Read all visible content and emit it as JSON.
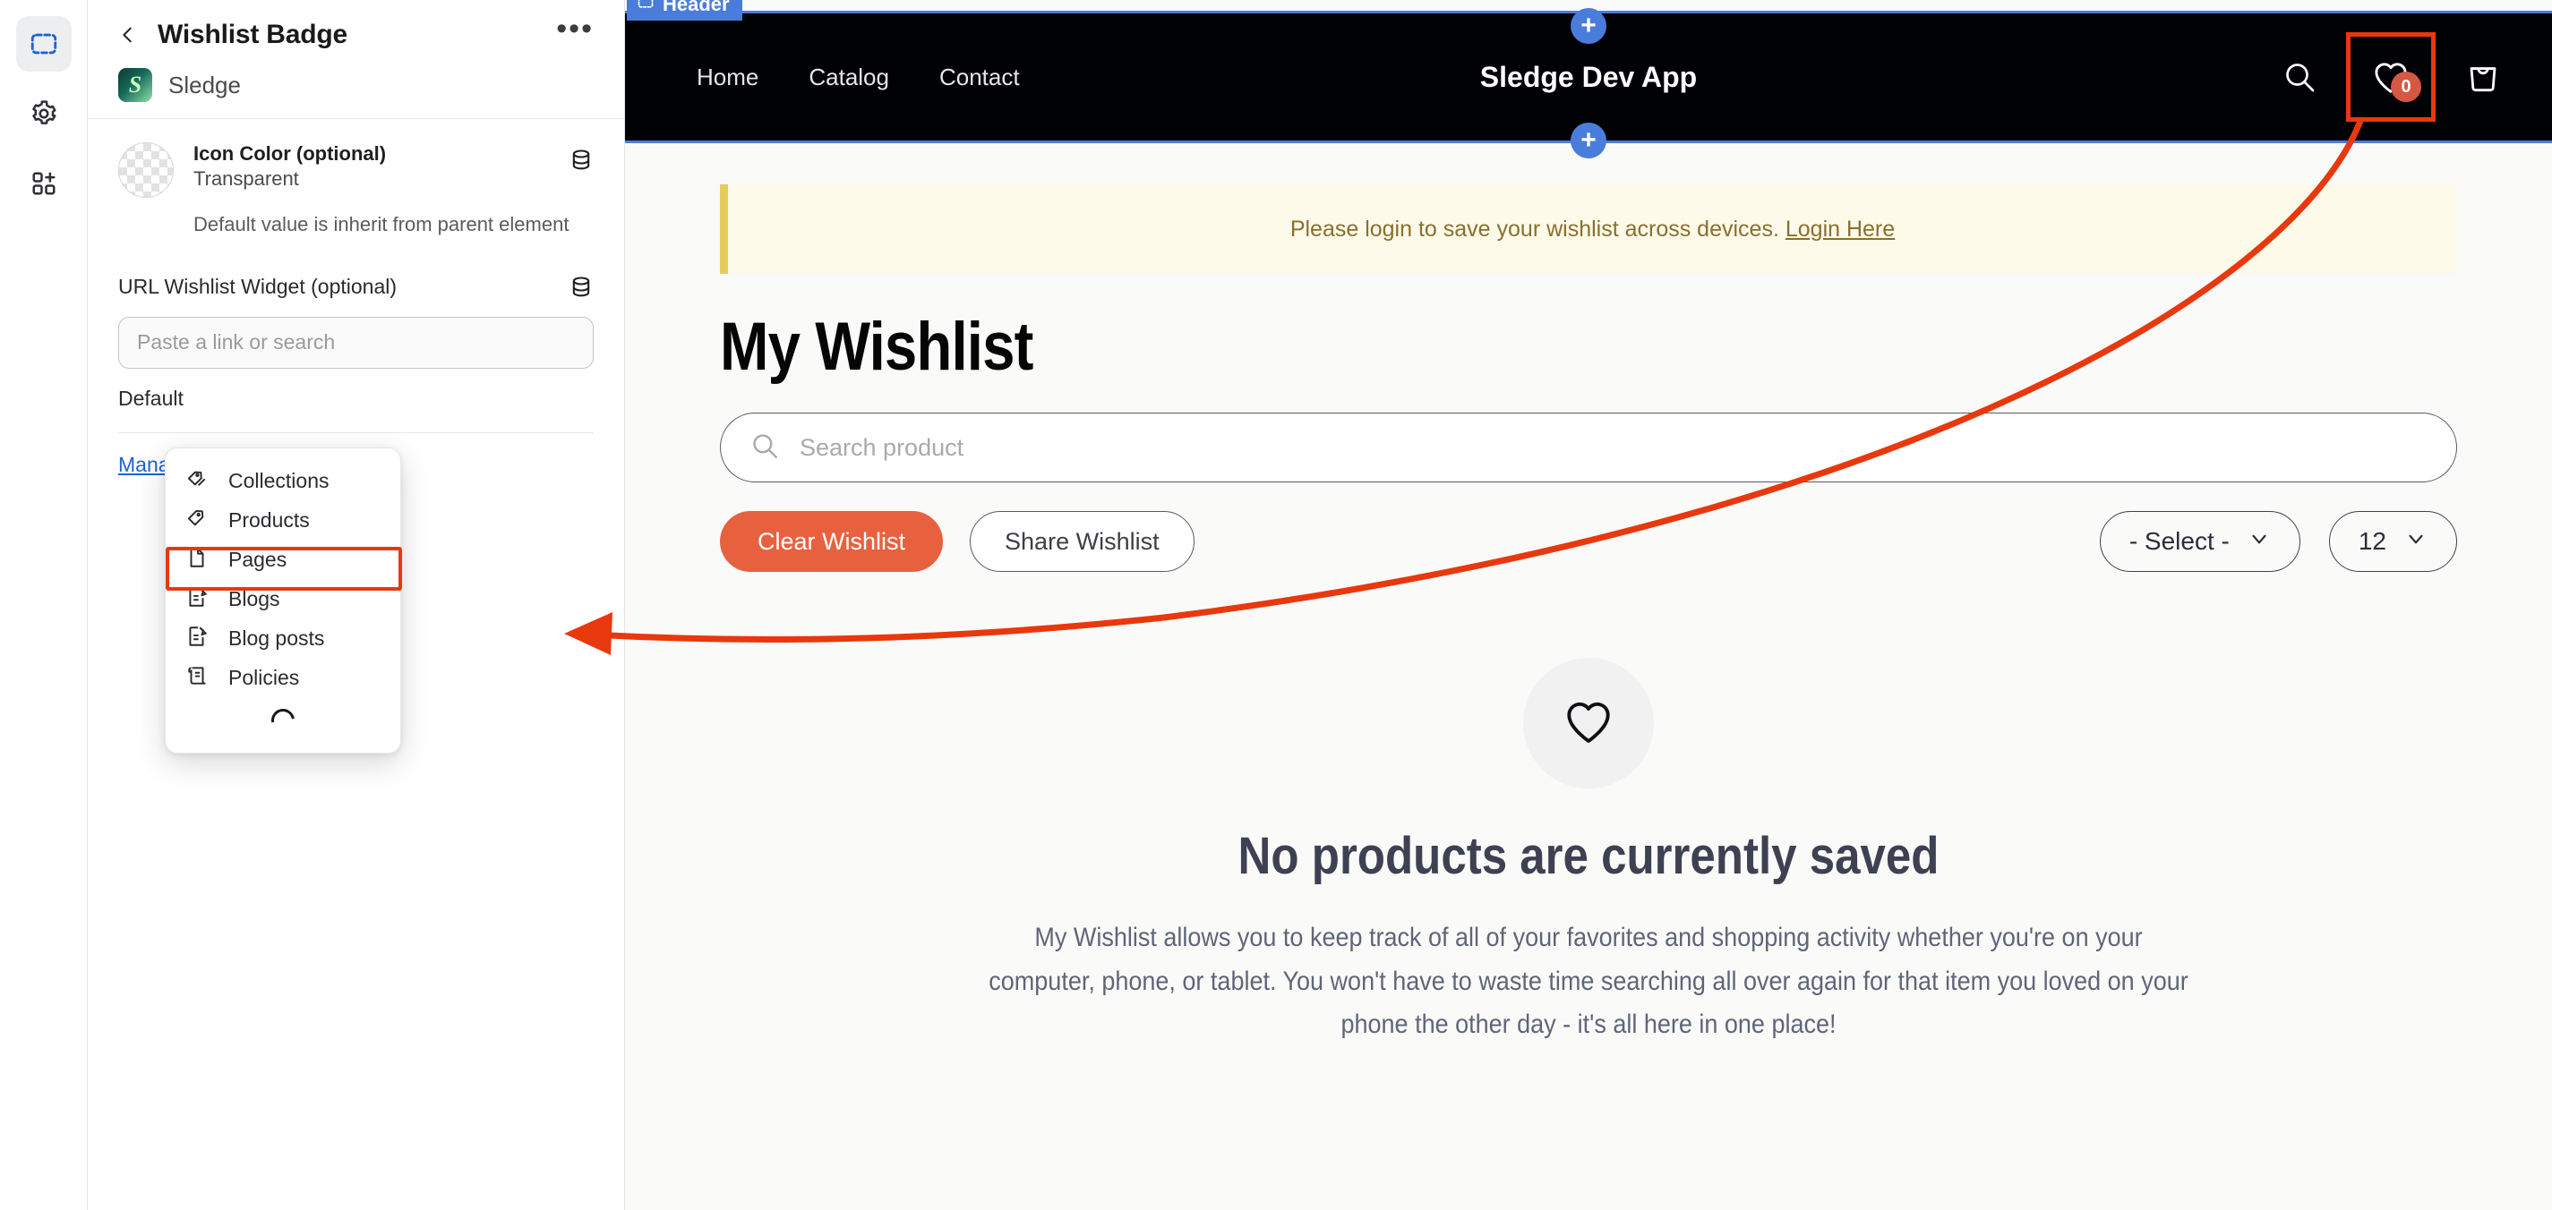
{
  "rail": {
    "items": [
      {
        "name": "sections-icon",
        "label": "Sections",
        "active": true
      },
      {
        "name": "gear-icon",
        "label": "Settings",
        "active": false
      },
      {
        "name": "apps-add-icon",
        "label": "Apps",
        "active": false
      }
    ]
  },
  "panel": {
    "back_label": "Back",
    "title": "Wishlist Badge",
    "more_label": "•••",
    "app_name": "Sledge",
    "app_logo_glyph": "S",
    "icon_color": {
      "label": "Icon Color (optional)",
      "value": "Transparent",
      "helper": "Default value is inherit from parent element",
      "db_icon": "database-icon"
    },
    "url_widget": {
      "label": "URL Wishlist Widget (optional)",
      "placeholder": "Paste a link or search",
      "value": "",
      "db_icon": "database-icon"
    },
    "default_label": "Default",
    "manage_link": "Manage"
  },
  "resource_menu": {
    "items": [
      {
        "label": "Collections",
        "icon": "tag-multiple-icon",
        "highlighted": false
      },
      {
        "label": "Products",
        "icon": "tag-icon",
        "highlighted": false
      },
      {
        "label": "Pages",
        "icon": "page-icon",
        "highlighted": true
      },
      {
        "label": "Blogs",
        "icon": "blog-edit-icon",
        "highlighted": false
      },
      {
        "label": "Blog posts",
        "icon": "blog-edit-icon",
        "highlighted": false
      },
      {
        "label": "Policies",
        "icon": "policies-icon",
        "highlighted": false
      }
    ],
    "loading": true,
    "highlight_color": "#e8380d"
  },
  "preview": {
    "header": {
      "badge_label": "Header",
      "badge_icon": "section-icon",
      "badge_color": "#4a7ddb",
      "nav": [
        "Home",
        "Catalog",
        "Contact"
      ],
      "store_title": "Sledge Dev App",
      "icons": [
        {
          "name": "search-icon",
          "label": "Search"
        },
        {
          "name": "wishlist-heart-icon",
          "label": "Wishlist",
          "badge": "0",
          "highlighted": true
        },
        {
          "name": "cart-bag-icon",
          "label": "Cart"
        }
      ],
      "add_section_label": "+"
    },
    "notice": {
      "text": "Please login to save your wishlist across devices.",
      "link": "Login Here",
      "bg": "#fdfaea",
      "accent": "#e6cd5b"
    },
    "page_title": "My Wishlist",
    "search": {
      "placeholder": "Search product",
      "value": "",
      "icon": "search-icon"
    },
    "buttons": {
      "clear": "Clear Wishlist",
      "share": "Share Wishlist",
      "clear_color": "#e8613f"
    },
    "selects": [
      {
        "name": "sort-select",
        "value": "- Select -"
      },
      {
        "name": "per-page-select",
        "value": "12"
      }
    ],
    "empty": {
      "icon": "heart-outline-icon",
      "title": "No products are currently saved",
      "description": "My Wishlist allows you to keep track of all of your favorites and shopping activity whether you're on your computer, phone, or tablet. You won't have to waste time searching all over again for that item you loved on your phone the other day - it's all here in one place!"
    }
  },
  "annotation": {
    "arrow_color": "#e8380d",
    "from": "wishlist-heart-icon",
    "to": "Pages"
  }
}
